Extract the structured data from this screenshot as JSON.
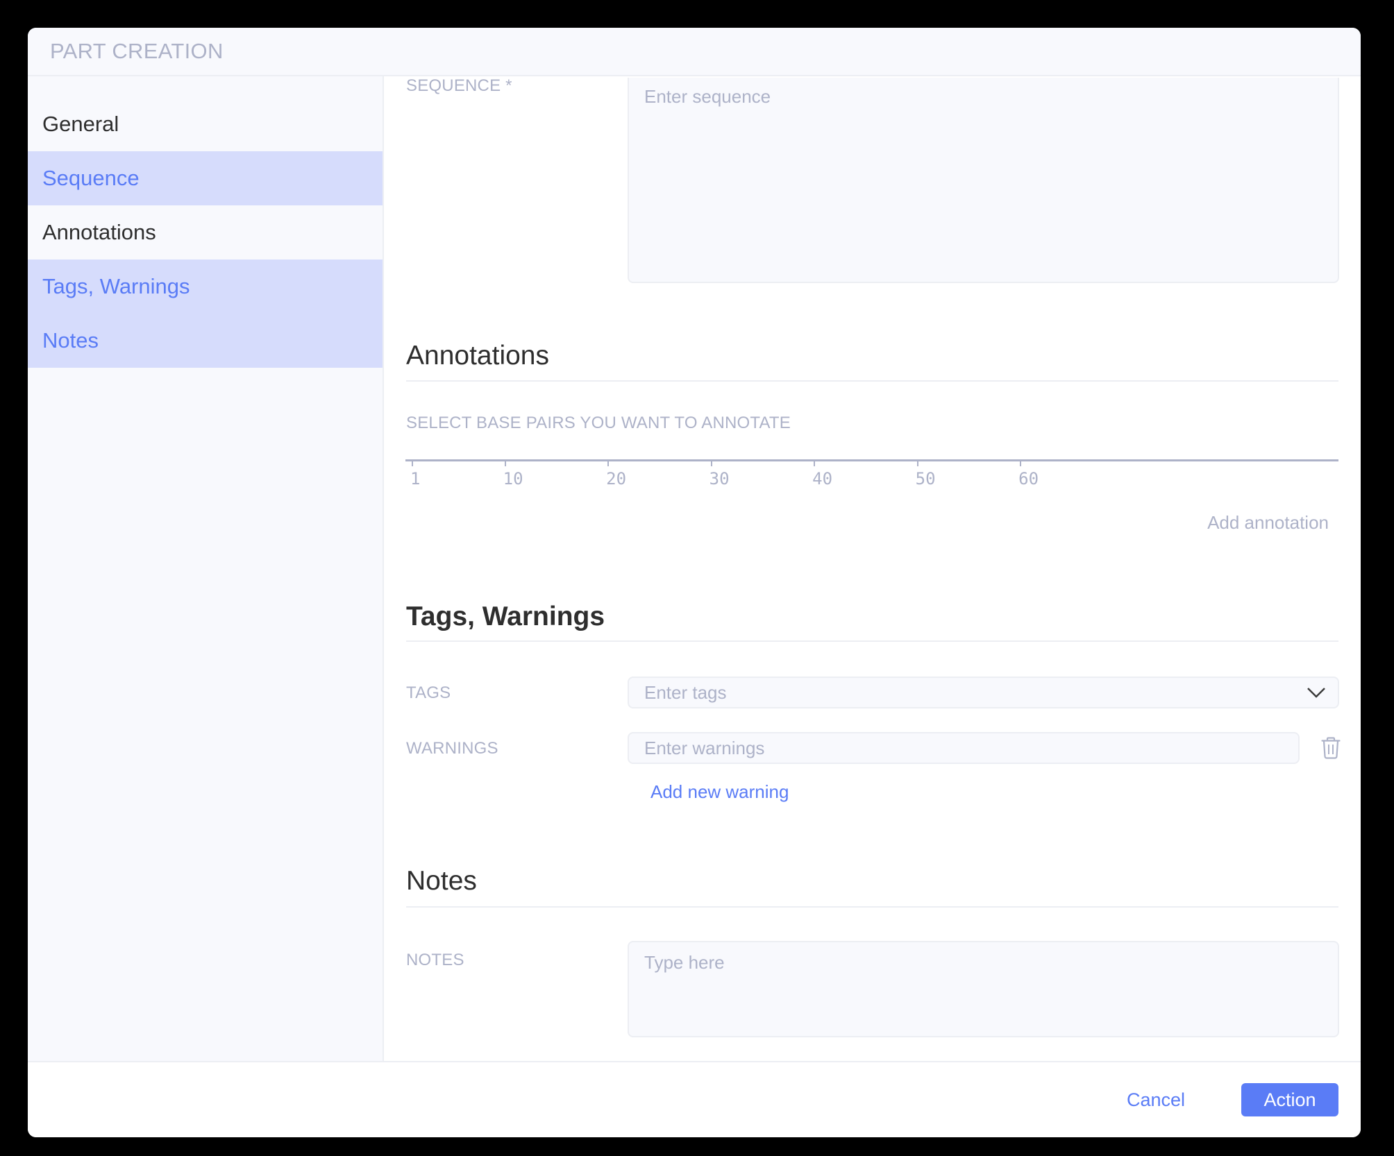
{
  "header": {
    "title": "PART CREATION"
  },
  "sidebar": {
    "items": [
      {
        "label": "General",
        "highlighted": false
      },
      {
        "label": "Sequence",
        "highlighted": true
      },
      {
        "label": "Annotations",
        "highlighted": false
      },
      {
        "label": "Tags, Warnings",
        "highlighted": true
      },
      {
        "label": "Notes",
        "highlighted": true
      }
    ]
  },
  "sequence": {
    "label": "SEQUENCE *",
    "placeholder": "Enter sequence",
    "value": ""
  },
  "annotations": {
    "title": "Annotations",
    "select_label": "SELECT BASE PAIRS YOU WANT TO ANNOTATE",
    "ruler_ticks": [
      "1",
      "10",
      "20",
      "30",
      "40",
      "50",
      "60"
    ],
    "add_label": "Add annotation"
  },
  "tags_warnings": {
    "title": "Tags, Warnings",
    "tags_label": "TAGS",
    "tags_placeholder": "Enter tags",
    "warnings_label": "WARNINGS",
    "warnings_placeholder": "Enter warnings",
    "add_warning_label": "Add new warning"
  },
  "notes": {
    "title": "Notes",
    "label": "NOTES",
    "placeholder": "Type here"
  },
  "footer": {
    "cancel_label": "Cancel",
    "action_label": "Action"
  },
  "colors": {
    "accent": "#5a7cf6",
    "highlight_bg": "#d6dcfc",
    "muted_text": "#adb2c8",
    "heading_text": "#2e2e2e"
  }
}
